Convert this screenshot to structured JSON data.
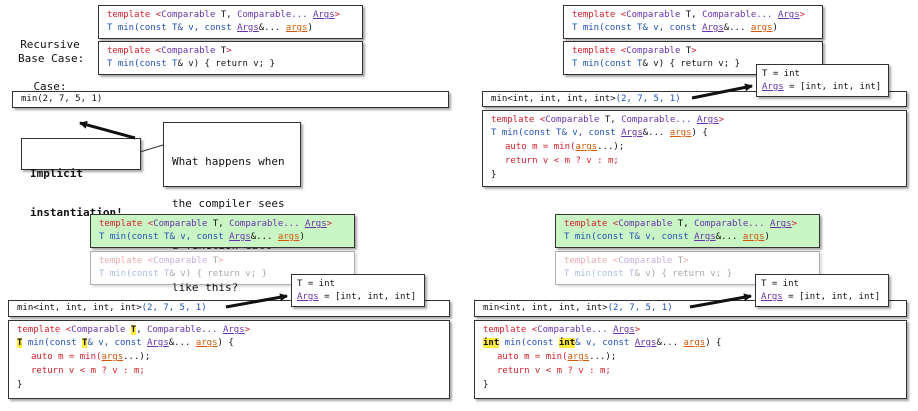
{
  "labels": {
    "recursive_1": "Recursive",
    "recursive_2": "Case:",
    "base": "Base Case:"
  },
  "code": {
    "template_open": "template <",
    "comparable": "Comparable",
    "comparable_dots": "Comparable...",
    "sep": ", ",
    "close": ">",
    "t": "T",
    "args": "Args",
    "args_lower": "args",
    "min_fn": " min(const ",
    "amp_v": "& v, const ",
    "amp_dots": "&... ",
    "close_paren": ")",
    "base_body": "& v) { return v; }",
    "open_brace": " {",
    "line_auto": "auto m = min(",
    "line_auto_end": "...);",
    "line_return": "return v < m ? v : m;",
    "close_brace": "}",
    "int": "int",
    "space": " "
  },
  "calls": {
    "plain": "min(2, 7, 5, 1)",
    "explicit_prefix": "min<int, int, int, int>",
    "explicit_args": "(2, 7, 5, 1)"
  },
  "bindings": {
    "t_eq": "T = int",
    "args_name": "Args",
    "args_rest": " = [int, int, int]"
  },
  "callout": {
    "question_1": "What happens when",
    "question_2": "the compiler sees",
    "question_3": "a function call",
    "question_4": "like this?",
    "implicit_1": "Implicit",
    "implicit_2": "instantiation!"
  }
}
